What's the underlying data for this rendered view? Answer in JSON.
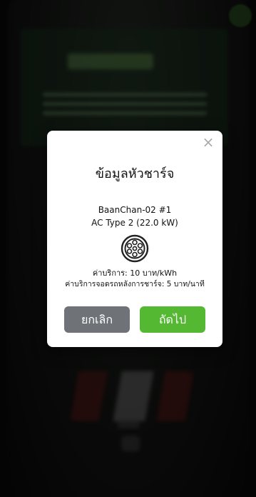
{
  "modal": {
    "title": "ข้อมูลหัวชาร์จ",
    "station_name": "BaanChan-02 #1",
    "plug_type": "AC Type 2 (22.0 kW)",
    "service_fee": "ค่าบริการ: 10 บาท/kWh",
    "parking_fee": "ค่าบริการจอดรถหลังการชาร์จ: 5 บาท/นาที",
    "close_symbol": "×",
    "cancel_label": "ยกเลิก",
    "next_label": "ถัดไป",
    "connector_icon": "type2-connector-icon"
  },
  "colors": {
    "overlay": "rgba(0,0,0,0.55)",
    "cancel_button": "#6f7377",
    "next_button": "#55b833",
    "modal_bg": "#ffffff"
  }
}
